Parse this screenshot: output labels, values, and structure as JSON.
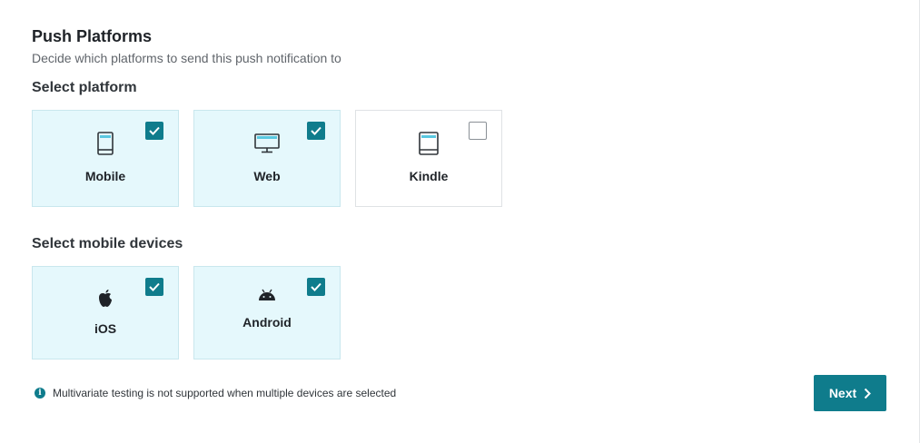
{
  "header": {
    "title": "Push Platforms",
    "description": "Decide which platforms to send this push notification to"
  },
  "platforms": {
    "label": "Select platform",
    "items": [
      {
        "label": "Mobile",
        "icon": "mobile-phone-icon",
        "checked": true
      },
      {
        "label": "Web",
        "icon": "desktop-monitor-icon",
        "checked": true
      },
      {
        "label": "Kindle",
        "icon": "tablet-icon",
        "checked": false
      }
    ]
  },
  "devices": {
    "label": "Select mobile devices",
    "items": [
      {
        "label": "iOS",
        "icon": "apple-icon",
        "checked": true
      },
      {
        "label": "Android",
        "icon": "android-icon",
        "checked": true
      }
    ]
  },
  "footer": {
    "info_text": "Multivariate testing is not supported when multiple devices are selected",
    "next_label": "Next"
  },
  "colors": {
    "accent": "#0f7c8c",
    "selected_card_bg": "#e5f8fc",
    "icon_highlight": "#59c8e0"
  }
}
